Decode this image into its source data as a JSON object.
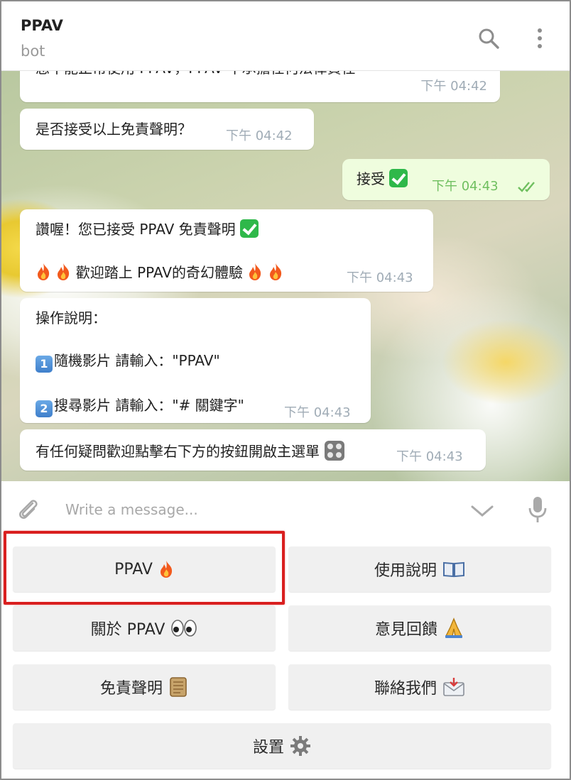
{
  "header": {
    "title": "PPAV",
    "subtitle": "bot",
    "search_icon": "search-icon",
    "menu_icon": "more-vertical-icon"
  },
  "messages": [
    {
      "id": "m0",
      "direction": "in",
      "text": "您不能正常使用 PPAV，PPAV 不承擔任何法律責任",
      "time": "下午 04:42"
    },
    {
      "id": "m1",
      "direction": "in",
      "text": "是否接受以上免責聲明？",
      "time": "下午 04:42"
    },
    {
      "id": "m2",
      "direction": "out",
      "text": "接受",
      "emoji": "check-mark-icon",
      "time": "下午 04:43",
      "status": "read-double-check"
    },
    {
      "id": "m3",
      "direction": "in",
      "line1": "讚喔！您已接受 PPAV 免責聲明",
      "line2": "歡迎踏上 PPAV的奇幻體驗",
      "time": "下午 04:43"
    },
    {
      "id": "m4",
      "direction": "in",
      "title": "操作說明：",
      "step1_num": "1",
      "step1": "隨機影片 請輸入：\"PPAV\"",
      "step2_num": "2",
      "step2": "搜尋影片 請輸入：\"# 關鍵字\"",
      "time": "下午 04:43"
    },
    {
      "id": "m5",
      "direction": "in",
      "text": "有任何疑問歡迎點擊右下方的按鈕開啟主選單",
      "time": "下午 04:43"
    }
  ],
  "input": {
    "placeholder": "Write a message...",
    "attach_icon": "paperclip-icon",
    "collapse_icon": "chevron-down-icon",
    "mic_icon": "microphone-icon"
  },
  "keyboard": {
    "buttons": [
      {
        "label": "PPAV",
        "icon": "fire-icon",
        "highlighted": true
      },
      {
        "label": "使用說明",
        "icon": "book-icon"
      },
      {
        "label": "關於 PPAV",
        "icon": "eyes-icon"
      },
      {
        "label": "意見回饋",
        "icon": "folded-hands-icon"
      },
      {
        "label": "免責聲明",
        "icon": "scroll-icon"
      },
      {
        "label": "聯絡我們",
        "icon": "envelope-icon"
      },
      {
        "label": "設置",
        "icon": "gear-icon"
      }
    ]
  },
  "colors": {
    "accent_out_bubble": "#effdde",
    "read_check": "#6fbf5f",
    "highlight_box": "#d91f1f"
  }
}
